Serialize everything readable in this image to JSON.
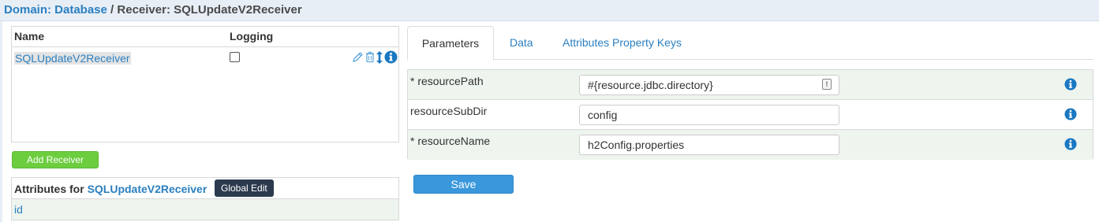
{
  "header": {
    "domain_label": "Domain: Database",
    "separator": " / ",
    "receiver_label": "Receiver: SQLUpdateV2Receiver"
  },
  "receivers": {
    "columns": [
      "Name",
      "Logging"
    ],
    "rows": [
      {
        "name": "SQLUpdateV2Receiver",
        "logging": false
      }
    ]
  },
  "add_receiver_label": "Add Receiver",
  "attributes": {
    "label_prefix": "Attributes for ",
    "receiver_name": "SQLUpdateV2Receiver",
    "global_edit_label": "Global Edit",
    "items": [
      "id"
    ]
  },
  "tabs": [
    "Parameters",
    "Data",
    "Attributes Property Keys"
  ],
  "active_tab": "Parameters",
  "parameters": [
    {
      "label": "* resourcePath",
      "value": "#{resource.jdbc.directory}"
    },
    {
      "label": "resourceSubDir",
      "value": "config"
    },
    {
      "label": "* resourceName",
      "value": "h2Config.properties"
    }
  ],
  "save_label": "Save",
  "colors": {
    "link": "#2a7fc0",
    "add_button": "#6ccd3f",
    "save_button": "#3a97dc",
    "global_edit": "#2b3a4d",
    "info_icon": "#1a78c2"
  },
  "icons": [
    "pencil-icon",
    "trash-icon",
    "sort-icon",
    "info-icon",
    "variable-icon"
  ]
}
